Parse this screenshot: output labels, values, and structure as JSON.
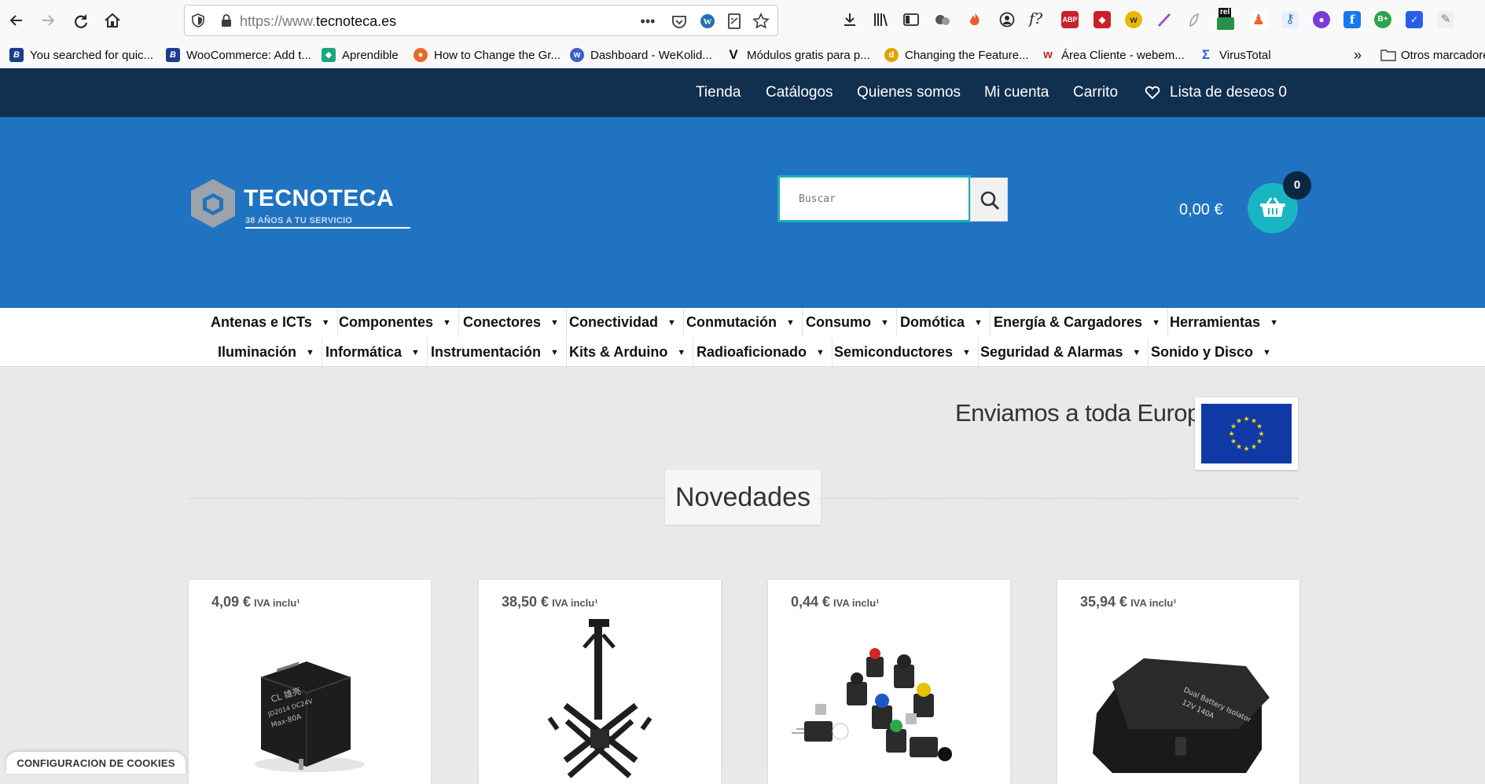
{
  "browser": {
    "url_prefix": "https://www.",
    "url_domain": "tecnoteca.es",
    "bookmarks": [
      {
        "label": "You searched for quic...",
        "color": "#1c3d8f",
        "glyph": "B"
      },
      {
        "label": "WooCommerce: Add t...",
        "color": "#1c3d8f",
        "glyph": "B"
      },
      {
        "label": "Aprendible",
        "color": "#1aa67a",
        "glyph": "◆"
      },
      {
        "label": "How to Change the Gr...",
        "color": "#e8692a",
        "glyph": "●"
      },
      {
        "label": "Dashboard - WeKolid...",
        "color": "#3a5fd0",
        "glyph": "w"
      },
      {
        "label": "Módulos gratis para p...",
        "color": "#111111",
        "glyph": "V"
      },
      {
        "label": "Changing the Feature...",
        "color": "#e0a400",
        "glyph": "d"
      },
      {
        "label": "Área Cliente - webem...",
        "color": "#c9202a",
        "glyph": "w"
      },
      {
        "label": "VirusTotal",
        "color": "#2f5ee0",
        "glyph": "Σ"
      }
    ],
    "other_bookmarks": "Otros marcadores",
    "rel_badge": "rel",
    "extensions": [
      {
        "name": "abp-icon",
        "label": "ABP",
        "color": "#c7232c"
      },
      {
        "name": "shield-ext-icon",
        "label": "◆",
        "color": "#c9202a"
      },
      {
        "name": "w-ext-icon",
        "label": "w",
        "color": "#e6b800"
      },
      {
        "name": "feather-icon",
        "label": "/",
        "color": "#a64dd6"
      },
      {
        "name": "leaf-icon",
        "label": "/",
        "color": "#9aa0a6"
      },
      {
        "name": "rel-icon",
        "label": "rel",
        "color": "#2a8f4a"
      },
      {
        "name": "person-ext-icon",
        "label": "♟",
        "color": "#f0632a"
      },
      {
        "name": "key-icon",
        "label": "⚷",
        "color": "#1e74c6"
      },
      {
        "name": "circle-ext-icon",
        "label": "●",
        "color": "#7a3cd6"
      },
      {
        "name": "facebook-icon",
        "label": "f",
        "color": "#1877f2"
      },
      {
        "name": "b-plus-icon",
        "label": "B+",
        "color": "#2ea44f"
      },
      {
        "name": "check-ext-icon",
        "label": "✓",
        "color": "#2a5ee8"
      },
      {
        "name": "pencil-ext-icon",
        "label": "✎",
        "color": "#8a8a8a"
      }
    ]
  },
  "topnav": {
    "items": [
      "Tienda",
      "Catálogos",
      "Quienes somos",
      "Mi cuenta",
      "Carrito"
    ],
    "wishlist": "Lista de deseos 0"
  },
  "header": {
    "logo_name": "TECNOTECA",
    "logo_tagline": "38 AÑOS A TU SERVICIO",
    "search_placeholder": "Buscar",
    "cart_total": "0,00 €",
    "cart_count": "0",
    "brand_color": "#1f73c1",
    "accent_color": "#19b6c2"
  },
  "categories": {
    "row1": [
      "Antenas e ICTs",
      "Componentes",
      "Conectores",
      "Conectividad",
      "Conmutación",
      "Consumo",
      "Domótica",
      "Energía & Cargadores",
      "Herramientas"
    ],
    "row2": [
      "Iluminación",
      "Informática",
      "Instrumentación",
      "Kits & Arduino",
      "Radioaficionado",
      "Semiconductores",
      "Seguridad & Alarmas",
      "Sonido y Disco"
    ]
  },
  "content": {
    "shipping_text": "Enviamos a toda Europa:",
    "section_title": "Novedades",
    "products": [
      {
        "price": "4,09 €",
        "tax": "IVA inclu¹"
      },
      {
        "price": "38,50 €",
        "tax": "IVA inclu¹"
      },
      {
        "price": "0,44 €",
        "tax": "IVA inclu¹"
      },
      {
        "price": "35,94 €",
        "tax": "IVA inclu¹"
      }
    ]
  },
  "cookie_tab": "CONFIGURACION DE COOKIES"
}
